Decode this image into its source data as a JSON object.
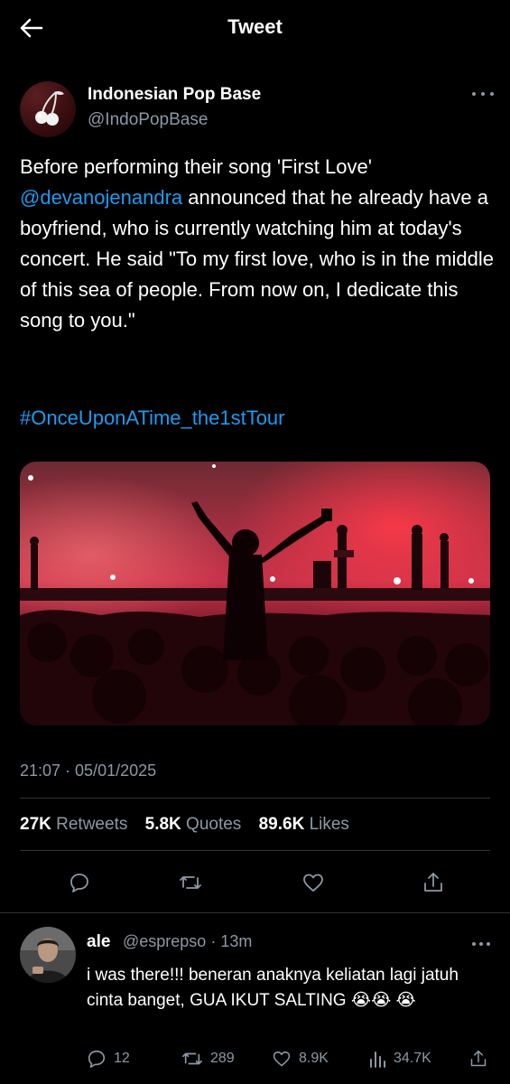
{
  "header": {
    "title": "Tweet",
    "back_icon": "arrow-left-icon"
  },
  "author": {
    "name": "Indonesian Pop Base",
    "handle": "@IndoPopBase",
    "avatar_icon": "cherry-logo-icon"
  },
  "tweet": {
    "text_before": "Before performing their song 'First Love' ",
    "mention": "@devanojenandra",
    "text_after": " announced that he already have a boyfriend, who is currently watching him at today's concert. He said \"To my first love, who is in the middle of this sea of people. From now on, I dedicate this song to you.\"",
    "hashtag": "#OnceUponATime_the1stTour",
    "timestamp": "21:07 · 05/01/2025"
  },
  "stats": {
    "retweets_value": "27K",
    "retweets_label": "Retweets",
    "quotes_value": "5.8K",
    "quotes_label": "Quotes",
    "likes_value": "89.6K",
    "likes_label": "Likes"
  },
  "actions": [
    "reply-icon",
    "retweet-icon",
    "heart-icon",
    "share-icon"
  ],
  "reply": {
    "name": "ale",
    "handle_time": "@esprepso · 13m",
    "text": "i was there!!! beneran anaknya keliatan lagi jatuh cinta banget, GUA IKUT SALTING 😭😭 😭",
    "replies": "12",
    "retweets": "289",
    "likes": "8.9K",
    "views": "34.7K"
  },
  "colors": {
    "accent": "#1d9bf0",
    "muted": "#8b98a5",
    "background": "#000000"
  }
}
